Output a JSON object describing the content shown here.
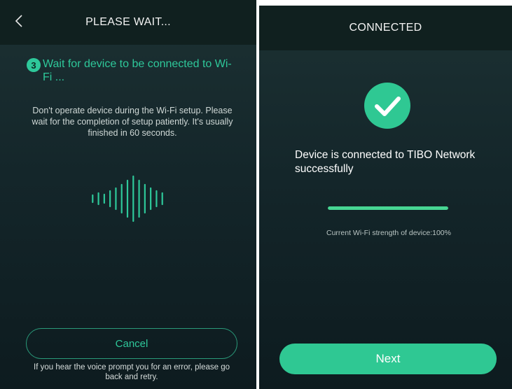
{
  "left_screen": {
    "title": "PLEASE WAIT...",
    "back_icon": "chevron-left-icon",
    "step_number": "3",
    "step_title": "Wait for device to be connected to Wi-Fi ...",
    "description": "Don't operate device during the Wi-Fi setup. Please wait for the completion of setup patiently. It's usually finished in 60 seconds.",
    "wave_icon": "sound-wave-icon",
    "cancel_label": "Cancel",
    "error_hint": "If you hear the voice prompt you for an error, please go back and retry."
  },
  "right_screen": {
    "title": "CONNECTED",
    "check_icon": "check-circle-icon",
    "success_message": "Device is connected to TIBO Network successfully",
    "wifi_strength_label": "Current Wi-Fi strength of device:100%",
    "wifi_strength_level": 1.0,
    "next_label": "Next"
  },
  "colors": {
    "accent": "#2ec89a",
    "button_fill": "#2fc893",
    "bar_fill": "#47d693",
    "bg_dark": "#10201f"
  }
}
